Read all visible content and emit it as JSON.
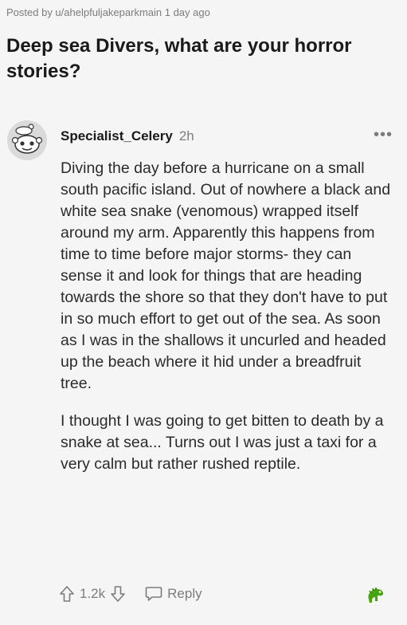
{
  "post": {
    "meta": "Posted by u/ahelpfuljakeparkmain 1 day ago",
    "title": "Deep sea Divers, what are your horror stories?"
  },
  "comment": {
    "author": "Specialist_Celery",
    "age": "2h",
    "more_icon": "ellipsis-icon",
    "paragraphs": [
      "Diving the day before a hurricane on a small south pacific island. Out of nowhere a black and white sea snake (venomous) wrapped itself around my arm. Apparently this happens from time to time before major storms- they can sense it and look for things that are heading towards the shore so that they don't have to put in so much effort to get out of the sea. As soon as I was in the shallows it uncurled and headed up the beach where it hid under a breadfruit tree.",
      "I thought I was going to get bitten to death by a snake at sea... Turns out I was just a taxi for a very calm but rather rushed reptile."
    ],
    "score": "1.2k",
    "reply_label": "Reply",
    "award_icon": "dinosaur-award-icon",
    "award_color": "#46a508"
  }
}
